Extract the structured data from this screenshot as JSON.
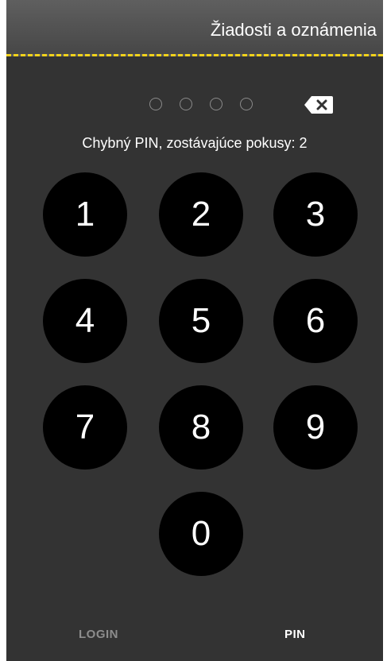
{
  "header": {
    "title": "Žiadosti a oznámenia"
  },
  "pin": {
    "entered_digits": 0,
    "total_digits": 4,
    "backspace_icon": "backspace-icon",
    "status_message": "Chybný PIN, zostávajúce pokusy: 2"
  },
  "keypad": {
    "keys": [
      "1",
      "2",
      "3",
      "4",
      "5",
      "6",
      "7",
      "8",
      "9",
      "0"
    ]
  },
  "bottom_tabs": {
    "login_label": "LOGIN",
    "pin_label": "PIN",
    "active": "PIN"
  },
  "colors": {
    "background": "#333333",
    "header_accent": "#f2d21b",
    "key_background": "#000000",
    "text": "#ffffff",
    "inactive_tab": "#8d8d8d"
  }
}
